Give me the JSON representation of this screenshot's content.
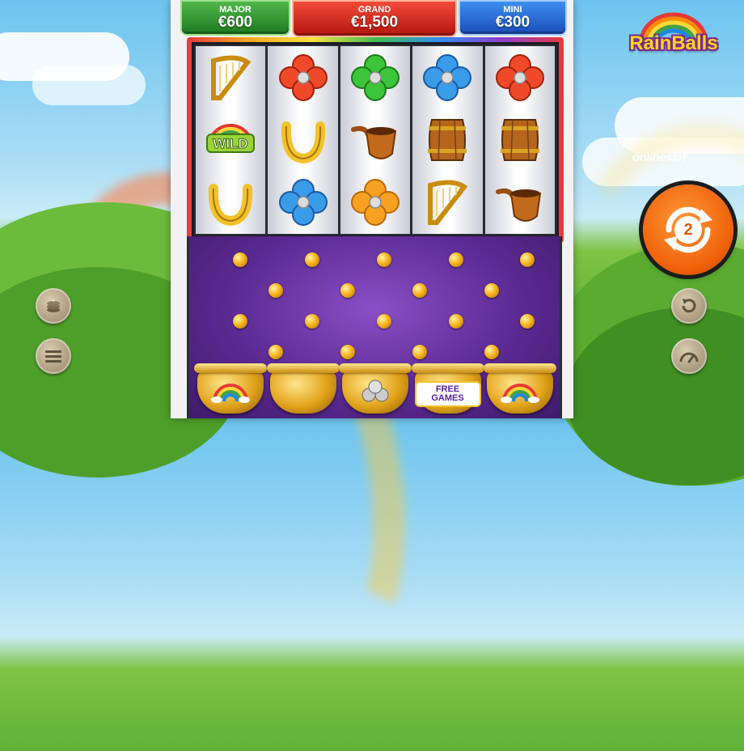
{
  "jackpots": {
    "major": {
      "label": "MAJOR",
      "amount": "€600"
    },
    "grand": {
      "label": "GRAND",
      "amount": "€1,500"
    },
    "mini": {
      "label": "MINI",
      "amount": "€300"
    }
  },
  "logo": {
    "text": "RainBalls"
  },
  "watermark": "onlineslot",
  "reels": [
    [
      "harp-icon",
      "wild-icon",
      "horseshoe-icon"
    ],
    [
      "red-clover-icon",
      "horseshoe-icon",
      "blue-clover-icon"
    ],
    [
      "green-clover-icon",
      "pipe-icon",
      "orange-clover-icon"
    ],
    [
      "blue-clover-icon",
      "barrel-icon",
      "harp-icon"
    ],
    [
      "red-clover-icon",
      "barrel-icon",
      "pipe-icon"
    ]
  ],
  "wild_label": "WILD",
  "pots": [
    "rainbow-pot",
    "empty-pot",
    "balls-pot",
    "free-games-pot",
    "rainbow-pot"
  ],
  "free_games_label": "FREE GAMES",
  "spin": {
    "count": "2"
  },
  "controls": {
    "left": [
      "coin-stack-icon",
      "menu-icon"
    ],
    "right": [
      "autoplay-icon",
      "speed-gauge-icon"
    ]
  },
  "colors": {
    "major": "#2f9a2f",
    "grand": "#d42a1d",
    "mini": "#2b6ad8",
    "spin": "#f0620a",
    "peg_board": "#5b2a93"
  }
}
